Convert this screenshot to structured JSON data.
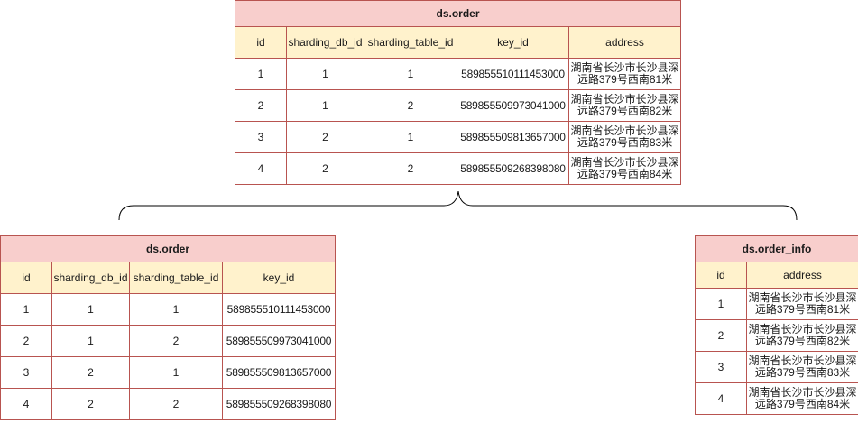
{
  "top_table": {
    "title": "ds.order",
    "headers": [
      "id",
      "sharding_db_id",
      "sharding_table_id",
      "key_id",
      "address"
    ],
    "rows": [
      [
        "1",
        "1",
        "1",
        "589855510111453000",
        "湖南省长沙市长沙县深远路379号西南81米"
      ],
      [
        "2",
        "1",
        "2",
        "589855509973041000",
        "湖南省长沙市长沙县深远路379号西南82米"
      ],
      [
        "3",
        "2",
        "1",
        "589855509813657000",
        "湖南省长沙市长沙县深远路379号西南83米"
      ],
      [
        "4",
        "2",
        "2",
        "589855509268398080",
        "湖南省长沙市长沙县深远路379号西南84米"
      ]
    ]
  },
  "left_table": {
    "title": "ds.order",
    "headers": [
      "id",
      "sharding_db_id",
      "sharding_table_id",
      "key_id"
    ],
    "rows": [
      [
        "1",
        "1",
        "1",
        "589855510111453000"
      ],
      [
        "2",
        "1",
        "2",
        "589855509973041000"
      ],
      [
        "3",
        "2",
        "1",
        "589855509813657000"
      ],
      [
        "4",
        "2",
        "2",
        "589855509268398080"
      ]
    ]
  },
  "right_table": {
    "title": "ds.order_info",
    "headers": [
      "id",
      "address"
    ],
    "rows": [
      [
        "1",
        "湖南省长沙市长沙县深远路379号西南81米"
      ],
      [
        "2",
        "湖南省长沙市长沙县深远路379号西南82米"
      ],
      [
        "3",
        "湖南省长沙市长沙县深远路379号西南83米"
      ],
      [
        "4",
        "湖南省长沙市长沙县深远路379号西南84米"
      ]
    ]
  },
  "colors": {
    "title_fill": "#f8cecc",
    "header_fill": "#fff2cc",
    "border": "#b85450"
  }
}
